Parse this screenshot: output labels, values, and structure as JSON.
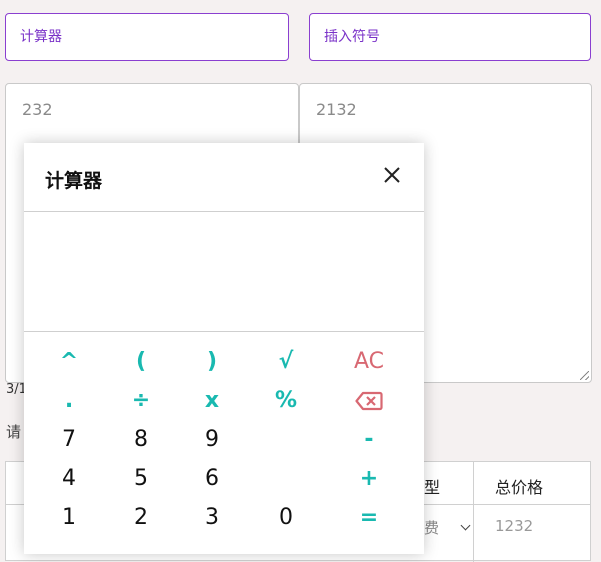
{
  "toolbar": {
    "calculator_label": "计算器",
    "insert_symbol_label": "插入符号"
  },
  "editors": {
    "left_value": "232",
    "right_value": "2132"
  },
  "counter": "3/1",
  "hint": "请",
  "table": {
    "header_type_partial": "型",
    "header_total_price": "总价格",
    "select_partial": "费",
    "price_value": "1232"
  },
  "calculator": {
    "title": "计算器",
    "display_value": "",
    "keys": {
      "power": "^",
      "lparen": "(",
      "rparen": ")",
      "sqrt": "√",
      "clear": "AC",
      "dot": ".",
      "divide": "÷",
      "multiply": "x",
      "percent": "%",
      "minus": "-",
      "plus": "+",
      "equals": "=",
      "d7": "7",
      "d8": "8",
      "d9": "9",
      "d4": "4",
      "d5": "5",
      "d6": "6",
      "d1": "1",
      "d2": "2",
      "d3": "3",
      "d0": "0"
    },
    "icons": {
      "close": "close-icon",
      "backspace": "backspace-icon"
    },
    "colors": {
      "operator": "#19b9b0",
      "clear": "#d86872",
      "accent": "#7a32c8"
    }
  }
}
